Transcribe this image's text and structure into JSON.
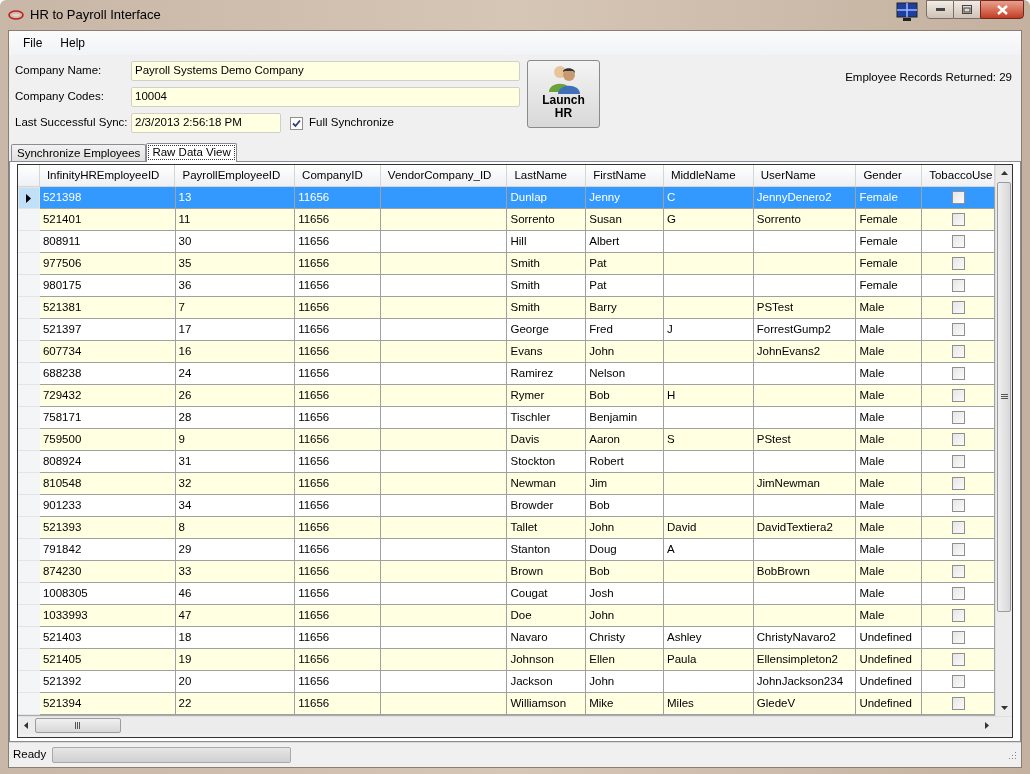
{
  "window": {
    "title": "HR to Payroll Interface"
  },
  "menu": [
    "File",
    "Help"
  ],
  "form": {
    "fields": [
      {
        "label": "Company Name:",
        "value": "Payroll Systems Demo Company"
      },
      {
        "label": "Company Codes:",
        "value": "10004"
      }
    ],
    "last_sync": {
      "label": "Last Successful Sync:",
      "value": "2/3/2013 2:56:18 PM"
    },
    "full_synchronize": {
      "label": "Full Synchronize",
      "checked": true
    },
    "launch_button": "Launch HR",
    "records_returned": "Employee Records Returned: 29"
  },
  "tabs": [
    {
      "label": "Synchronize Employees",
      "selected": false
    },
    {
      "label": "Raw Data View",
      "selected": true
    }
  ],
  "table": {
    "columns": [
      "InfinityHREmployeeID",
      "PayrollEmployeeID",
      "CompanyID",
      "VendorCompany_ID",
      "LastName",
      "FirstName",
      "MiddleName",
      "UserName",
      "Gender",
      "TobaccoUse"
    ],
    "rows": [
      {
        "cells": [
          "521398",
          "13",
          "11656",
          "",
          "Dunlap",
          "Jenny",
          "C",
          "JennyDenero2",
          "Female"
        ],
        "tobacco_user": false,
        "selected": true
      },
      {
        "cells": [
          "521401",
          "11",
          "11656",
          "",
          "Sorrento",
          "Susan",
          "G",
          "Sorrento",
          "Female"
        ],
        "tobacco_user": false,
        "selected": false
      },
      {
        "cells": [
          "808911",
          "30",
          "11656",
          "",
          "Hill",
          "Albert",
          "",
          "",
          "Female"
        ],
        "tobacco_user": false,
        "selected": false
      },
      {
        "cells": [
          "977506",
          "35",
          "11656",
          "",
          "Smith",
          "Pat",
          "",
          "",
          "Female"
        ],
        "tobacco_user": false,
        "selected": false
      },
      {
        "cells": [
          "980175",
          "36",
          "11656",
          "",
          "Smith",
          "Pat",
          "",
          "",
          "Female"
        ],
        "tobacco_user": false,
        "selected": false
      },
      {
        "cells": [
          "521381",
          "7",
          "11656",
          "",
          "Smith",
          "Barry",
          "",
          "PSTest",
          "Male"
        ],
        "tobacco_user": false,
        "selected": false
      },
      {
        "cells": [
          "521397",
          "17",
          "11656",
          "",
          "George",
          "Fred",
          "J",
          "ForrestGump2",
          "Male"
        ],
        "tobacco_user": false,
        "selected": false
      },
      {
        "cells": [
          "607734",
          "16",
          "11656",
          "",
          "Evans",
          "John",
          "",
          "JohnEvans2",
          "Male"
        ],
        "tobacco_user": false,
        "selected": false
      },
      {
        "cells": [
          "688238",
          "24",
          "11656",
          "",
          "Ramirez",
          "Nelson",
          "",
          "",
          "Male"
        ],
        "tobacco_user": false,
        "selected": false
      },
      {
        "cells": [
          "729432",
          "26",
          "11656",
          "",
          "Rymer",
          "Bob",
          "H",
          "",
          "Male"
        ],
        "tobacco_user": false,
        "selected": false
      },
      {
        "cells": [
          "758171",
          "28",
          "11656",
          "",
          "Tischler",
          "Benjamin",
          "",
          "",
          "Male"
        ],
        "tobacco_user": false,
        "selected": false
      },
      {
        "cells": [
          "759500",
          "9",
          "11656",
          "",
          "Davis",
          "Aaron",
          "S",
          "PStest",
          "Male"
        ],
        "tobacco_user": false,
        "selected": false
      },
      {
        "cells": [
          "808924",
          "31",
          "11656",
          "",
          "Stockton",
          "Robert",
          "",
          "",
          "Male"
        ],
        "tobacco_user": false,
        "selected": false
      },
      {
        "cells": [
          "810548",
          "32",
          "11656",
          "",
          "Newman",
          "Jim",
          "",
          "JimNewman",
          "Male"
        ],
        "tobacco_user": false,
        "selected": false
      },
      {
        "cells": [
          "901233",
          "34",
          "11656",
          "",
          "Browder",
          "Bob",
          "",
          "",
          "Male"
        ],
        "tobacco_user": false,
        "selected": false
      },
      {
        "cells": [
          "521393",
          "8",
          "11656",
          "",
          "Tallet",
          "John",
          "David",
          "DavidTextiera2",
          "Male"
        ],
        "tobacco_user": false,
        "selected": false
      },
      {
        "cells": [
          "791842",
          "29",
          "11656",
          "",
          "Stanton",
          "Doug",
          "A",
          "",
          "Male"
        ],
        "tobacco_user": false,
        "selected": false
      },
      {
        "cells": [
          "874230",
          "33",
          "11656",
          "",
          "Brown",
          "Bob",
          "",
          "BobBrown",
          "Male"
        ],
        "tobacco_user": false,
        "selected": false
      },
      {
        "cells": [
          "1008305",
          "46",
          "11656",
          "",
          "Cougat",
          "Josh",
          "",
          "",
          "Male"
        ],
        "tobacco_user": false,
        "selected": false
      },
      {
        "cells": [
          "1033993",
          "47",
          "11656",
          "",
          "Doe",
          "John",
          "",
          "",
          "Male"
        ],
        "tobacco_user": false,
        "selected": false
      },
      {
        "cells": [
          "521403",
          "18",
          "11656",
          "",
          "Navaro",
          "Christy",
          "Ashley",
          "ChristyNavaro2",
          "Undefined"
        ],
        "tobacco_user": false,
        "selected": false
      },
      {
        "cells": [
          "521405",
          "19",
          "11656",
          "",
          "Johnson",
          "Ellen",
          "Paula",
          "Ellensimpleton2",
          "Undefined"
        ],
        "tobacco_user": false,
        "selected": false
      },
      {
        "cells": [
          "521392",
          "20",
          "11656",
          "",
          "Jackson",
          "John",
          "",
          "JohnJackson234",
          "Undefined"
        ],
        "tobacco_user": false,
        "selected": false
      },
      {
        "cells": [
          "521394",
          "22",
          "11656",
          "",
          "Williamson",
          "Mike",
          "Miles",
          "GledeV",
          "Undefined"
        ],
        "tobacco_user": false,
        "selected": false
      }
    ]
  },
  "status_bar": {
    "text": "Ready",
    "progress": {
      "level": 0
    }
  }
}
